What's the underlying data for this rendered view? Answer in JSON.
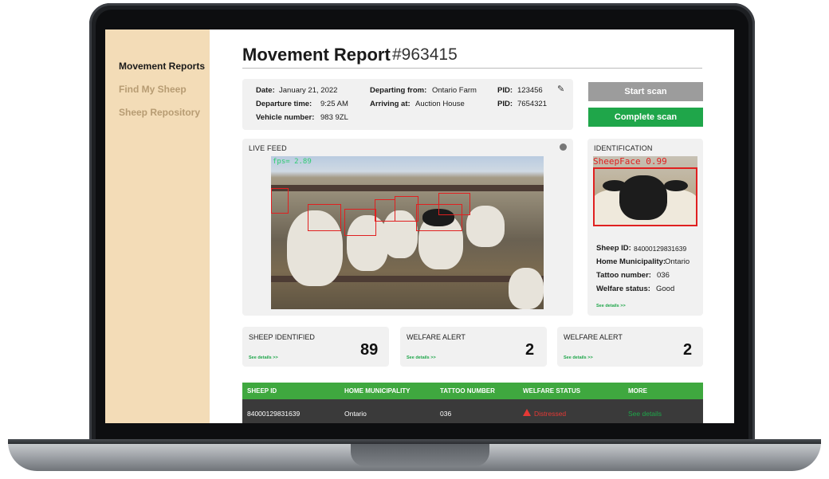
{
  "sidebar": {
    "items": [
      {
        "label": "Movement Reports"
      },
      {
        "label": "Find My Sheep"
      },
      {
        "label": "Sheep Repository"
      }
    ]
  },
  "header": {
    "title": "Movement Report",
    "report_id": "#963415"
  },
  "trip": {
    "date_label": "Date:",
    "date": "January 21, 2022",
    "departure_time_label": "Departure time:",
    "departure_time": "9:25 AM",
    "vehicle_label": "Vehicle number:",
    "vehicle": "983 9ZL",
    "departing_label": "Departing from:",
    "departing": "Ontario Farm",
    "arriving_label": "Arriving at:",
    "arriving": "Auction House",
    "pid1_label": "PID:",
    "pid1": "123456",
    "pid2_label": "PID:",
    "pid2": "7654321"
  },
  "actions": {
    "start_scan": "Start scan",
    "complete_scan": "Complete scan"
  },
  "live_feed": {
    "title": "LIVE FEED",
    "fps_text": "fps= 2.89"
  },
  "identification": {
    "title": "IDENTIFICATION",
    "detection_label": "SheepFace 0.99",
    "sheep_id_label": "Sheep ID:",
    "sheep_id": "84000129831639",
    "municipality_label": "Home Municipality:",
    "municipality": "Ontario",
    "tattoo_label": "Tattoo number:",
    "tattoo": "036",
    "welfare_label": "Welfare status:",
    "welfare": "Good",
    "see_details": "See details >>"
  },
  "stats": [
    {
      "title": "SHEEP IDENTIFIED",
      "value": "89",
      "see_details": "See details >>"
    },
    {
      "title": "WELFARE ALERT",
      "value": "2",
      "see_details": "See details >>"
    },
    {
      "title": "WELFARE ALERT",
      "value": "2",
      "see_details": "See details >>"
    }
  ],
  "table": {
    "headers": [
      "SHEEP ID",
      "HOME MUNICIPALITY",
      "TATTOO NUMBER",
      "WELFARE STATUS",
      "MORE"
    ],
    "rows": [
      {
        "sheep_id": "84000129831639",
        "municipality": "Ontario",
        "tattoo": "036",
        "status": "Distressed",
        "more": "See details"
      }
    ]
  },
  "colors": {
    "sidebar_bg": "#f3dcb7",
    "accent_green": "#1fa64a",
    "table_header": "#3fa83f",
    "alert_red": "#e53935"
  }
}
